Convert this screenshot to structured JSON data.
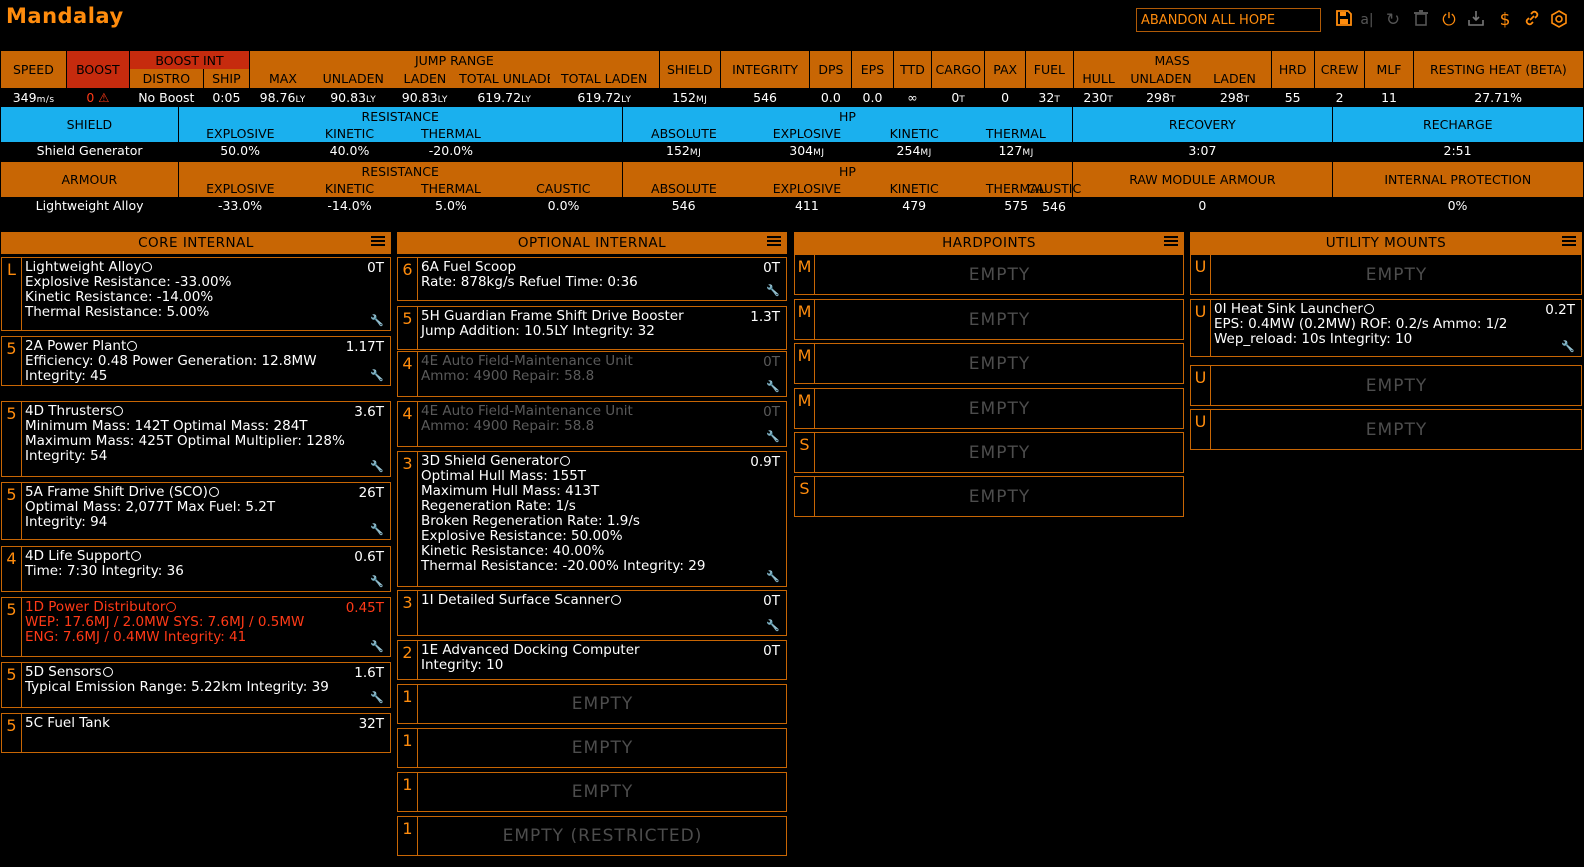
{
  "header": {
    "title": "Mandalay",
    "build_name": "ABANDON ALL HOPE",
    "icons": [
      "save-icon",
      "rename-icon",
      "reload-icon",
      "delete-icon",
      "power-icon",
      "export-icon",
      "cost-icon",
      "link-icon",
      "coriolis-icon"
    ]
  },
  "colors": {
    "orange": "#c86604",
    "blue": "#1ab0ee",
    "red": "#c62b0e",
    "text_orange": "#ff8c0d"
  },
  "stats": {
    "headers": {
      "speed": "SPEED",
      "boost": "BOOST",
      "boost_int": "BOOST INT",
      "distro": "DISTRO",
      "ship": "SHIP",
      "jump_range": "JUMP RANGE",
      "max": "MAX",
      "unladen": "UNLADEN",
      "laden": "LADEN",
      "total_unladen": "TOTAL UNLADEN",
      "total_laden": "TOTAL LADEN",
      "shield": "SHIELD",
      "integrity": "INTEGRITY",
      "dps": "DPS",
      "eps": "EPS",
      "ttd": "TTD",
      "cargo": "CARGO",
      "pax": "PAX",
      "fuel": "FUEL",
      "mass": "MASS",
      "hull": "HULL",
      "mass_unladen": "UNLADEN",
      "mass_laden": "LADEN",
      "hrd": "HRD",
      "crew": "CREW",
      "mlf": "MLF",
      "resting_heat": "RESTING HEAT (BETA)"
    },
    "values": {
      "speed": "349",
      "speed_unit": "m/s",
      "boost": "0",
      "distro": "No Boost",
      "ship": "0:05",
      "max": "98.76",
      "unladen": "90.83",
      "laden": "90.83",
      "total_unladen": "619.72",
      "total_laden": "619.72",
      "ly": "LY",
      "shield": "152",
      "mj": "MJ",
      "integrity": "546",
      "dps": "0.0",
      "eps": "0.0",
      "ttd": "∞",
      "cargo": "0",
      "t": "T",
      "pax": "0",
      "fuel": "32",
      "hull": "230",
      "mass_unladen": "298",
      "mass_laden": "298",
      "hrd": "55",
      "crew": "2",
      "mlf": "11",
      "resting_heat": "27.71%"
    }
  },
  "shield_table": {
    "label": "SHIELD",
    "resistance": "RESISTANCE",
    "hp": "HP",
    "recovery": "RECOVERY",
    "recharge": "RECHARGE",
    "explosive": "EXPLOSIVE",
    "kinetic": "KINETIC",
    "thermal": "THERMAL",
    "absolute": "ABSOLUTE",
    "row": {
      "name": "Shield Generator",
      "res_exp": "50.0%",
      "res_kin": "40.0%",
      "res_therm": "-20.0%",
      "hp_abs": "152",
      "hp_exp": "304",
      "hp_kin": "254",
      "hp_therm": "127",
      "recovery": "3:07",
      "recharge": "2:51"
    }
  },
  "armour_table": {
    "label": "ARMOUR",
    "resistance": "RESISTANCE",
    "hp": "HP",
    "raw": "RAW MODULE ARMOUR",
    "internal": "INTERNAL PROTECTION",
    "explosive": "EXPLOSIVE",
    "kinetic": "KINETIC",
    "thermal": "THERMAL",
    "caustic": "CAUSTIC",
    "absolute": "ABSOLUTE",
    "row": {
      "name": "Lightweight Alloy",
      "res_exp": "-33.0%",
      "res_kin": "-14.0%",
      "res_therm": "5.0%",
      "res_caus": "0.0%",
      "hp_abs": "546",
      "hp_exp": "411",
      "hp_kin": "479",
      "hp_therm": "575",
      "hp_caus": "546",
      "raw": "0",
      "internal": "0%"
    }
  },
  "columns": {
    "core": {
      "title": "CORE INTERNAL"
    },
    "optional": {
      "title": "OPTIONAL INTERNAL"
    },
    "hardpoints": {
      "title": "HARDPOINTS"
    },
    "utility": {
      "title": "UTILITY MOUNTS"
    }
  },
  "core": [
    {
      "cls": "L",
      "name": "Lightweight Alloy",
      "mass": "0T",
      "l1": "Explosive Resistance: -33.00%",
      "l2": "Kinetic Resistance: -14.00%",
      "l3": "Thermal Resistance: 5.00%"
    },
    {
      "cls": "5",
      "name": "2A Power Plant",
      "mass": "1.17T",
      "l1": "Efficiency: 0.48  Power Generation: 12.8MW",
      "l2": "Integrity: 45"
    },
    {
      "cls": "5",
      "name": "4D Thrusters",
      "mass": "3.6T",
      "l1": "Minimum Mass: 142T  Optimal Mass: 284T",
      "l2": "Maximum Mass: 425T  Optimal Multiplier: 128%",
      "l3": "Integrity: 54"
    },
    {
      "cls": "5",
      "name": "5A Frame Shift Drive (SCO)",
      "mass": "26T",
      "l1": "Optimal Mass: 2,077T  Max Fuel: 5.2T",
      "l2": "Integrity: 94"
    },
    {
      "cls": "4",
      "name": "4D Life Support",
      "mass": "0.6T",
      "l1": "Time: 7:30  Integrity: 36"
    },
    {
      "cls": "5",
      "name": "1D Power Distributor",
      "mass": "0.45T",
      "l1": "WEP: 17.6MJ / 2.0MW  SYS: 7.6MJ / 0.5MW",
      "l2": "ENG: 7.6MJ / 0.4MW  Integrity: 41"
    },
    {
      "cls": "5",
      "name": "5D Sensors",
      "mass": "1.6T",
      "l1": "Typical Emission Range: 5.22km  Integrity: 39"
    },
    {
      "cls": "5",
      "name": "5C Fuel Tank",
      "mass": "32T"
    }
  ],
  "optional": [
    {
      "cls": "6",
      "name": "6A Fuel Scoop",
      "mass": "0T",
      "l1": "Rate: 878kg/s  Refuel Time: 0:36"
    },
    {
      "cls": "5",
      "name": "5H Guardian Frame Shift Drive Booster",
      "mass": "1.3T",
      "l1": "Jump Addition: 10.5LY  Integrity: 32"
    },
    {
      "cls": "4",
      "name": "4E Auto Field-Maintenance Unit",
      "mass": "0T",
      "l1": "Ammo: 4900  Repair: 58.8"
    },
    {
      "cls": "4",
      "name": "4E Auto Field-Maintenance Unit",
      "mass": "0T",
      "l1": "Ammo: 4900  Repair: 58.8"
    },
    {
      "cls": "3",
      "name": "3D Shield Generator",
      "mass": "0.9T",
      "l1": "Optimal Hull Mass: 155T",
      "l2": "Maximum Hull Mass: 413T",
      "l3": "Regeneration Rate: 1/s",
      "l4": "Broken Regeneration Rate: 1.9/s",
      "l5": "Explosive Resistance: 50.00%",
      "l6": "Kinetic Resistance: 40.00%",
      "l7": "Thermal Resistance: -20.00%  Integrity: 29"
    },
    {
      "cls": "3",
      "name": "1I Detailed Surface Scanner",
      "mass": "0T"
    },
    {
      "cls": "2",
      "name": "1E Advanced Docking Computer",
      "mass": "0T",
      "l1": "Integrity: 10"
    },
    {
      "cls": "1",
      "empty": "EMPTY"
    },
    {
      "cls": "1",
      "empty": "EMPTY"
    },
    {
      "cls": "1",
      "empty": "EMPTY"
    },
    {
      "cls": "1",
      "empty": "EMPTY (RESTRICTED)"
    }
  ],
  "hardpoints": [
    {
      "cls": "M",
      "empty": "EMPTY"
    },
    {
      "cls": "M",
      "empty": "EMPTY"
    },
    {
      "cls": "M",
      "empty": "EMPTY"
    },
    {
      "cls": "M",
      "empty": "EMPTY"
    },
    {
      "cls": "S",
      "empty": "EMPTY"
    },
    {
      "cls": "S",
      "empty": "EMPTY"
    }
  ],
  "utility": [
    {
      "cls": "U",
      "empty": "EMPTY"
    },
    {
      "cls": "U",
      "name": "0I Heat Sink Launcher",
      "mass": "0.2T",
      "l1": "EPS: 0.4MW (0.2MW)  ROF: 0.2/s  Ammo: 1/2",
      "l2": "Wep_reload: 10s  Integrity: 10"
    },
    {
      "cls": "U",
      "empty": "EMPTY"
    },
    {
      "cls": "U",
      "empty": "EMPTY"
    }
  ]
}
